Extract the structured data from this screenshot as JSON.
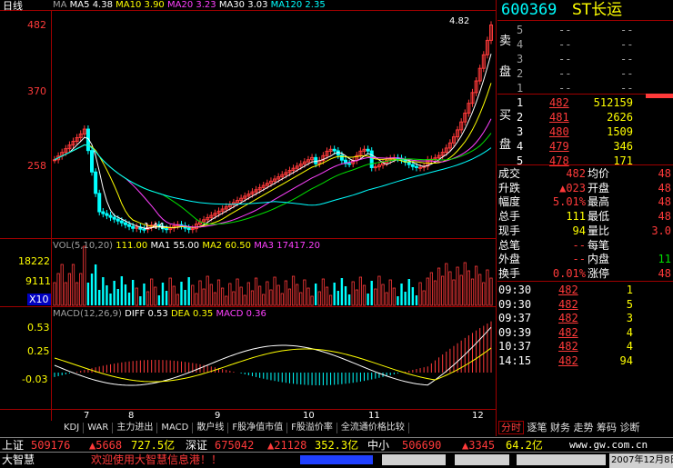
{
  "colors": {
    "up": "#ff3a3a",
    "down": "#00ffff",
    "ma5": "#ffffff",
    "ma10": "#ffff00",
    "ma20": "#ff40ff",
    "ma30": "#00e000",
    "ma120": "#00ffff"
  },
  "header": {
    "period": "日线",
    "ma_prefix": "MA",
    "ma5_label": "MA5",
    "ma5_value": "4.38",
    "ma10_label": "MA10",
    "ma10_value": "3.90",
    "ma20_label": "MA20",
    "ma20_value": "3.23",
    "ma30_label": "MA30",
    "ma30_value": "3.03",
    "ma120_label": "MA120",
    "ma120_value": "2.35"
  },
  "price_axis": [
    "482",
    "370",
    "258"
  ],
  "price_marks": {
    "high": "4.82",
    "low": "1.44"
  },
  "volume": {
    "title": "VOL(5,10,20)",
    "val": "111.00",
    "ma1_label": "MA1",
    "ma1_value": "55.00",
    "ma2_label": "MA2",
    "ma2_value": "60.50",
    "ma3_label": "MA3",
    "ma3_value": "17417.20",
    "axis": [
      "18222",
      "9111"
    ],
    "unit": "X10"
  },
  "macd": {
    "title": "MACD(12,26,9)",
    "diff_label": "DIFF",
    "diff_value": "0.53",
    "dea_label": "DEA",
    "dea_value": "0.35",
    "macd_label": "MACD",
    "macd_value": "0.36",
    "axis": [
      "0.53",
      "0.25",
      "-0.03"
    ]
  },
  "months": [
    "7",
    "8",
    "9",
    "10",
    "11",
    "12"
  ],
  "indicator_tabs": [
    "KDJ",
    "WAR",
    "主力进出",
    "MACD",
    "散户线",
    "F股净值市值",
    "F股溢价率",
    "全流通价格比较"
  ],
  "stock": {
    "code": "600369",
    "name": "ST长运"
  },
  "order_book": {
    "sell_label": [
      "卖",
      "盘"
    ],
    "buy_label": [
      "买",
      "盘"
    ],
    "sells": [
      {
        "n": "5",
        "price": "--",
        "vol": "--"
      },
      {
        "n": "4",
        "price": "--",
        "vol": "--"
      },
      {
        "n": "3",
        "price": "--",
        "vol": "--"
      },
      {
        "n": "2",
        "price": "--",
        "vol": "--"
      },
      {
        "n": "1",
        "price": "--",
        "vol": "--"
      }
    ],
    "buys": [
      {
        "n": "1",
        "price": "482",
        "vol": "512159"
      },
      {
        "n": "2",
        "price": "481",
        "vol": "2626"
      },
      {
        "n": "3",
        "price": "480",
        "vol": "1509"
      },
      {
        "n": "4",
        "price": "479",
        "vol": "346"
      },
      {
        "n": "5",
        "price": "478",
        "vol": "171"
      }
    ]
  },
  "quote": [
    {
      "l1": "成交",
      "v1": "482",
      "l2": "均价",
      "v2": "48"
    },
    {
      "l1": "升跌",
      "v1": "▲023",
      "l2": "开盘",
      "v2": "48"
    },
    {
      "l1": "幅度",
      "v1": "5.01%",
      "l2": "最高",
      "v2": "48"
    },
    {
      "l1": "总手",
      "v1": "111",
      "l2": "最低",
      "v2": "48"
    },
    {
      "l1": "现手",
      "v1": "94",
      "l2": "量比",
      "v2": "3.0"
    },
    {
      "l1": "总笔",
      "v1": "--",
      "l2": "每笔",
      "v2": ""
    },
    {
      "l1": "外盘",
      "v1": "--",
      "l2": "内盘",
      "v2": "11"
    },
    {
      "l1": "换手",
      "v1": "0.01%",
      "l2": "涨停",
      "v2": "48"
    }
  ],
  "ticks": [
    {
      "time": "09:30",
      "price": "482",
      "vol": "1"
    },
    {
      "time": "09:30",
      "price": "482",
      "vol": "5"
    },
    {
      "time": "09:37",
      "price": "482",
      "vol": "3"
    },
    {
      "time": "09:39",
      "price": "482",
      "vol": "4"
    },
    {
      "time": "10:37",
      "price": "482",
      "vol": "4"
    },
    {
      "time": "14:15",
      "price": "482",
      "vol": "94"
    }
  ],
  "right_tabs": [
    "分时",
    "逐笔",
    "财务",
    "走势",
    "筹码",
    "诊断"
  ],
  "status": {
    "sh_label": "上证",
    "sh_index": "509176",
    "sh_change": "▲5668",
    "sh_amount": "727.5亿",
    "sz_label": "深证",
    "sz_index": "675042",
    "sz_change": "▲21128",
    "sz_amount": "352.3亿",
    "zx_label": "中小",
    "zx_index": "506690",
    "zx_change": "▲3345",
    "zx_amount": "64.2亿",
    "url": "www.gw.com.cn"
  },
  "bottom": {
    "brand": "大智慧",
    "welcome": "欢迎使用大智慧信息港！！",
    "date": "2007年12月8日"
  }
}
